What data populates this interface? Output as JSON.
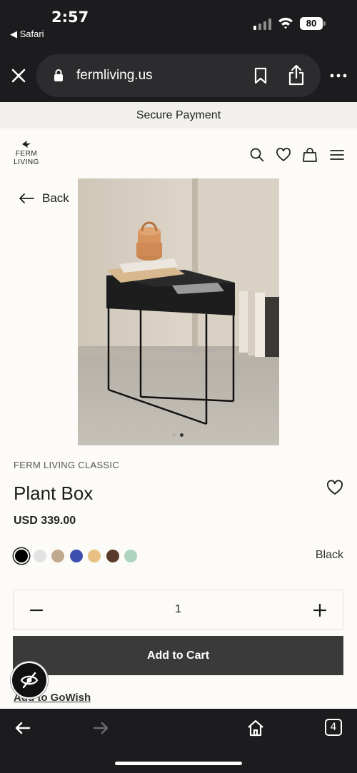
{
  "status_bar": {
    "time": "2:57",
    "back_app": "◀ Safari",
    "battery": "80"
  },
  "browser": {
    "url": "fermliving.us"
  },
  "banner": {
    "text": "Secure Payment"
  },
  "logo": {
    "line1": "FERM",
    "line2": "LIVING"
  },
  "nav": {
    "back_label": "Back"
  },
  "product": {
    "brand": "FERM LIVING CLASSIC",
    "title": "Plant Box",
    "price": "USD 339.00",
    "selected_color": "Black",
    "swatches": [
      "#000000",
      "#e3e3e3",
      "#bfa98f",
      "#3f4fb0",
      "#e9c185",
      "#5a3a2a",
      "#afd3be"
    ],
    "quantity": "1",
    "image_index": 2,
    "image_count": 2
  },
  "actions": {
    "add_to_cart": "Add to Cart",
    "add_to_gowish": "Add to GoWish"
  },
  "browser_toolbar": {
    "tab_count": "4"
  }
}
